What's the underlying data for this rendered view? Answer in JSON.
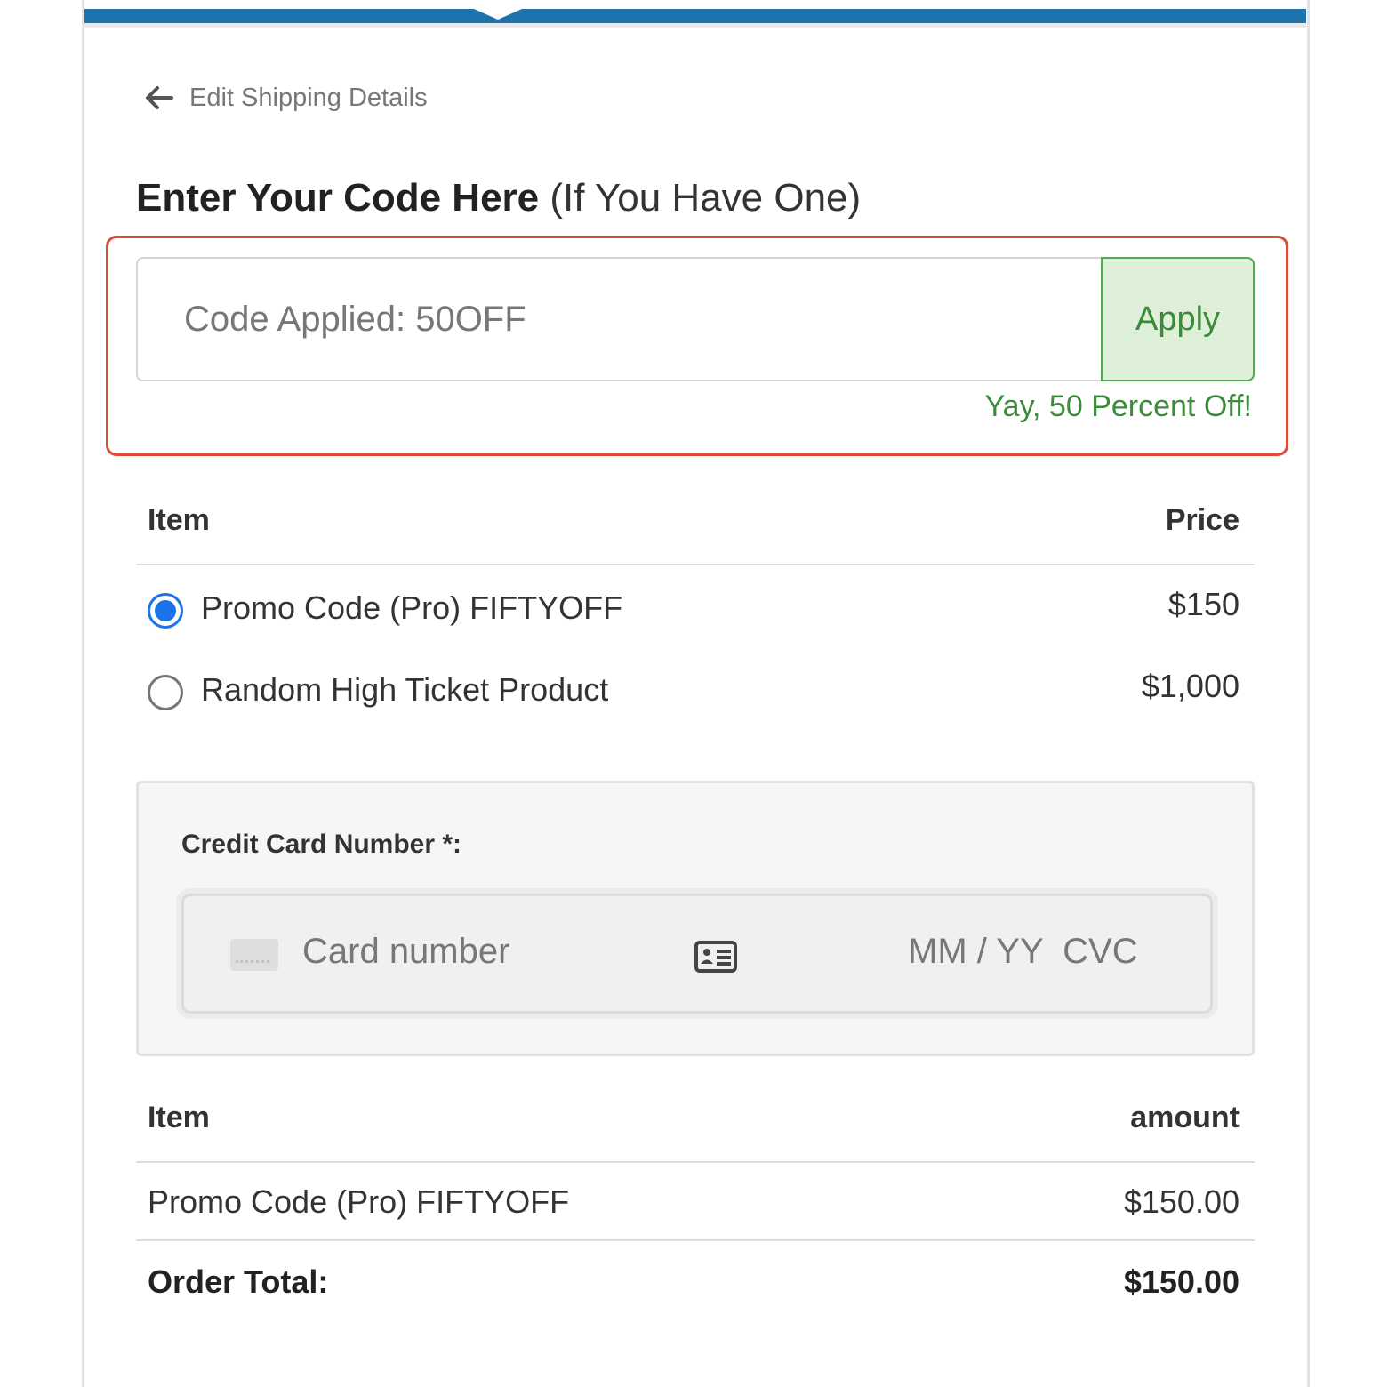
{
  "back_link": {
    "label": "Edit Shipping Details"
  },
  "coupon": {
    "title_bold": "Enter Your Code Here",
    "title_rest": "(If You Have One)",
    "input_value": "Code Applied: 50OFF",
    "apply_label": "Apply",
    "success_message": "Yay, 50 Percent Off!"
  },
  "products": {
    "header_item": "Item",
    "header_price": "Price",
    "rows": [
      {
        "name": "Promo Code (Pro) FIFTYOFF",
        "price": "$150",
        "selected": true
      },
      {
        "name": "Random High Ticket Product",
        "price": "$1,000",
        "selected": false
      }
    ]
  },
  "payment": {
    "label": "Credit Card Number *:",
    "card_placeholder": "Card number",
    "expiry_cvc_placeholder": "MM / YY  CVC"
  },
  "summary": {
    "header_item": "Item",
    "header_amount": "amount",
    "line_item": "Promo Code (Pro) FIFTYOFF",
    "line_amount": "$150.00",
    "total_label": "Order Total:",
    "total_amount": "$150.00"
  },
  "colors": {
    "top_bar": "#1f73ad",
    "success": "#3c8a3c",
    "highlight": "#dd4b39",
    "radio_selected": "#1a73e8"
  }
}
